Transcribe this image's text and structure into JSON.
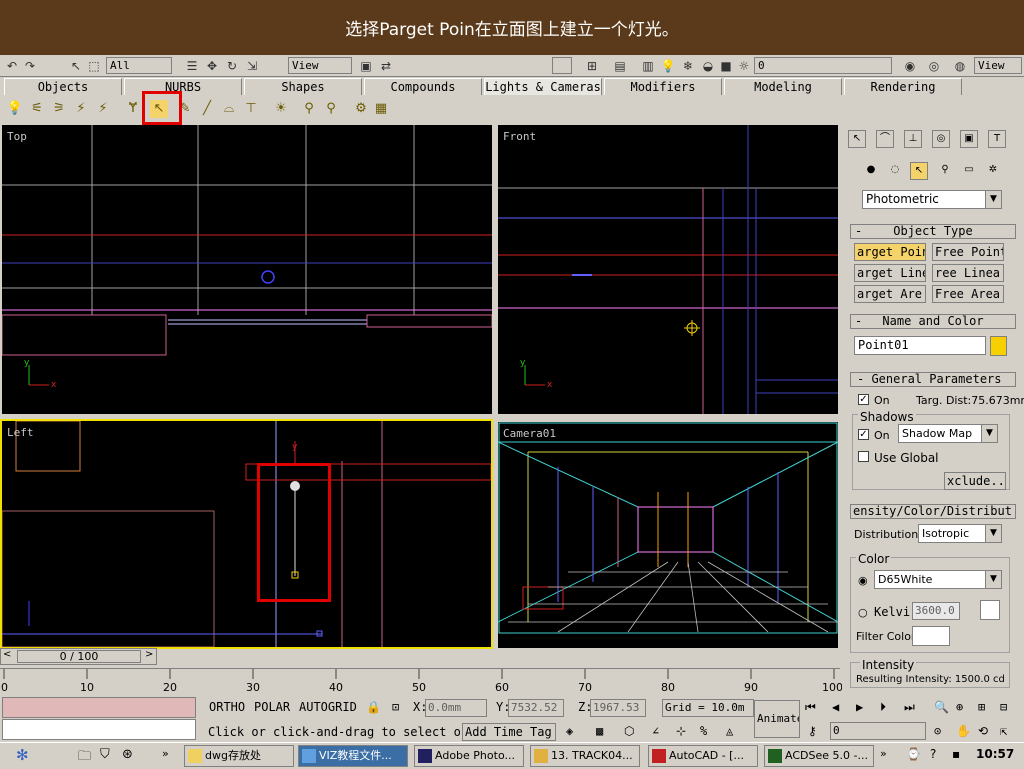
{
  "banner": {
    "text": "选择Parget Poin在立面图上建立一个灯光。"
  },
  "toolbar": {
    "selection_filter": "All",
    "ref_coord": "View",
    "ref_coord2": "View",
    "layer": "0"
  },
  "tabs": [
    {
      "label": "Objects"
    },
    {
      "label": "NURBS"
    },
    {
      "label": "Shapes"
    },
    {
      "label": "Compounds"
    },
    {
      "label": "Lights & Cameras"
    },
    {
      "label": "Modifiers"
    },
    {
      "label": "Modeling"
    },
    {
      "label": "Rendering"
    }
  ],
  "viewports": {
    "top": "Top",
    "front": "Front",
    "left": "Left",
    "camera": "Camera01"
  },
  "timeline": {
    "frame": "0 / 100",
    "ticks": [
      "0",
      "10",
      "20",
      "30",
      "40",
      "50",
      "60",
      "70",
      "80",
      "90",
      "100"
    ]
  },
  "status": {
    "ortho": "ORTHO",
    "polar": "POLAR",
    "autogrid": "AUTOGRID",
    "prompt": "Click or click-and-drag to select o",
    "add_time_tag": "Add Time Tag",
    "x_label": "X:",
    "x_value": "0.0mm",
    "y_label": "Y:",
    "y_value": "7532.52",
    "z_label": "Z:",
    "z_value": "1967.53",
    "grid": "Grid = 10.0m",
    "animate": "Animate",
    "frame_field": "0"
  },
  "panel": {
    "category": "Photometric",
    "object_type_title": "Object Type",
    "buttons": [
      {
        "label": "arget Poin",
        "selected": true
      },
      {
        "label": "Free Point",
        "selected": false
      },
      {
        "label": "arget Line",
        "selected": false
      },
      {
        "label": "ree Linea",
        "selected": false
      },
      {
        "label": "arget Are",
        "selected": false
      },
      {
        "label": "Free Area",
        "selected": false
      }
    ],
    "name_color_title": "Name and Color",
    "object_name": "Point01",
    "object_color": "#f6d000",
    "general_title": "General Parameters",
    "on_label": "On",
    "targ_dist": "Targ. Dist:75.673mm",
    "shadows_label": "Shadows",
    "shadow_on_label": "On",
    "shadow_type": "Shadow Map",
    "use_global": "Use Global",
    "exclude": "xclude...",
    "intensity_title": "ensity/Color/Distribut",
    "distribution_label": "Distribution:",
    "distribution_value": "Isotropic",
    "color_label": "Color",
    "color_preset": "D65White",
    "kelvin_label": "Kelvi",
    "kelvin_value": "3600.0",
    "filter_color_label": "Filter Color:",
    "intensity_label": "Intensity",
    "resulting_intensity": "Resulting Intensity: 1500.0 cd"
  },
  "taskbar": {
    "items": [
      {
        "label": "dwg存放处"
      },
      {
        "label": "VIZ教程文件..."
      },
      {
        "label": "Adobe Photo..."
      },
      {
        "label": "13. TRACK04..."
      },
      {
        "label": "AutoCAD - [..."
      },
      {
        "label": "ACDSee 5.0 -..."
      }
    ],
    "clock": "10:57"
  },
  "colors": {
    "accent_red": "#e00000",
    "viewport_active": "#f0e000",
    "selected_button": "#f3d36a"
  }
}
